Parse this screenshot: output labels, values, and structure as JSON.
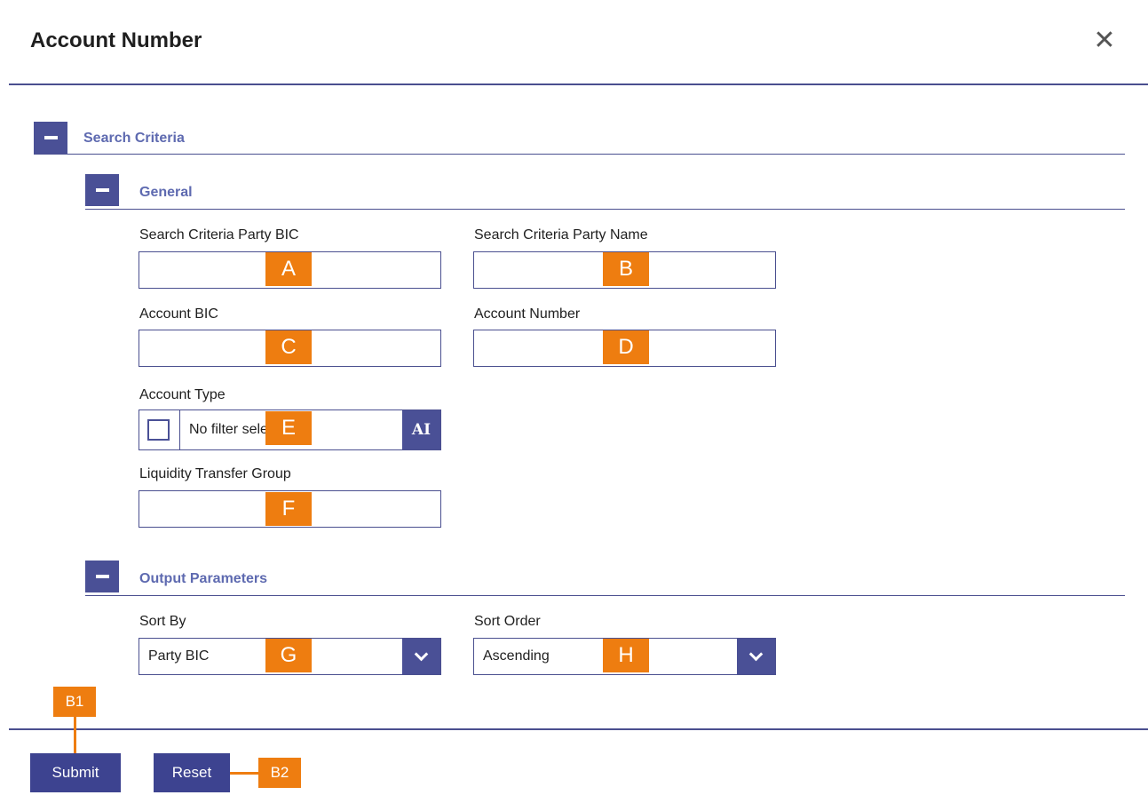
{
  "dialog": {
    "title": "Account Number"
  },
  "sections": {
    "search_criteria": {
      "label": "Search Criteria"
    },
    "general": {
      "label": "General"
    },
    "output": {
      "label": "Output Parameters"
    }
  },
  "fields": {
    "party_bic": {
      "label": "Search Criteria Party BIC",
      "value": ""
    },
    "party_name": {
      "label": "Search Criteria Party Name",
      "value": ""
    },
    "account_bic": {
      "label": "Account BIC",
      "value": ""
    },
    "account_number": {
      "label": "Account Number",
      "value": ""
    },
    "account_type": {
      "label": "Account Type",
      "value": "No filter selected",
      "button": "AI"
    },
    "ltg": {
      "label": "Liquidity Transfer Group",
      "value": ""
    },
    "sort_by": {
      "label": "Sort By",
      "value": "Party BIC"
    },
    "sort_order": {
      "label": "Sort Order",
      "value": "Ascending"
    }
  },
  "buttons": {
    "submit": "Submit",
    "reset": "Reset"
  },
  "markers": {
    "A": "A",
    "B": "B",
    "C": "C",
    "D": "D",
    "E": "E",
    "F": "F",
    "G": "G",
    "H": "H",
    "B1": "B1",
    "B2": "B2"
  },
  "icons": {
    "close": "close-icon",
    "collapse": "minus-icon",
    "chevron": "chevron-down-icon"
  },
  "colors": {
    "accent": "#4a5096",
    "marker": "#ee7d10",
    "section_label": "#5e6ab0"
  }
}
